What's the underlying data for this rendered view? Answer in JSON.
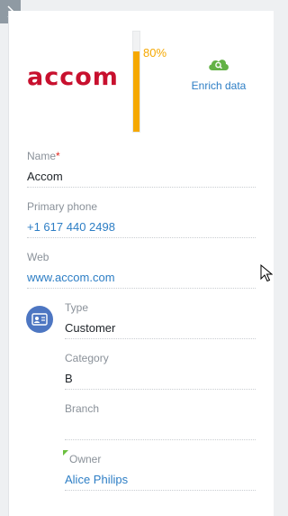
{
  "header": {
    "toggle_icon": "chevron-right-icon"
  },
  "profile": {
    "logo_text": "accom",
    "completeness": {
      "value": 0.8,
      "label": "80%"
    },
    "enrich": {
      "icon": "cloud-search-icon",
      "label": "Enrich data"
    }
  },
  "fields": {
    "name": {
      "label": "Name",
      "required": "*",
      "value": "Accom"
    },
    "phone": {
      "label": "Primary phone",
      "value": "+1 617 440 2498"
    },
    "web": {
      "label": "Web",
      "value": "www.accom.com"
    },
    "type": {
      "label": "Type",
      "value": "Customer",
      "icon": "contact-card-icon"
    },
    "category": {
      "label": "Category",
      "value": "B"
    },
    "branch": {
      "label": "Branch",
      "value": ""
    },
    "owner": {
      "label": "Owner",
      "value": "Alice Philips"
    }
  },
  "colors": {
    "accent": "#2d7ec5",
    "brand": "#c8102e",
    "progress": "#f5a800",
    "icon_bg": "#4d76c2",
    "enrich_icon": "#63b246"
  }
}
